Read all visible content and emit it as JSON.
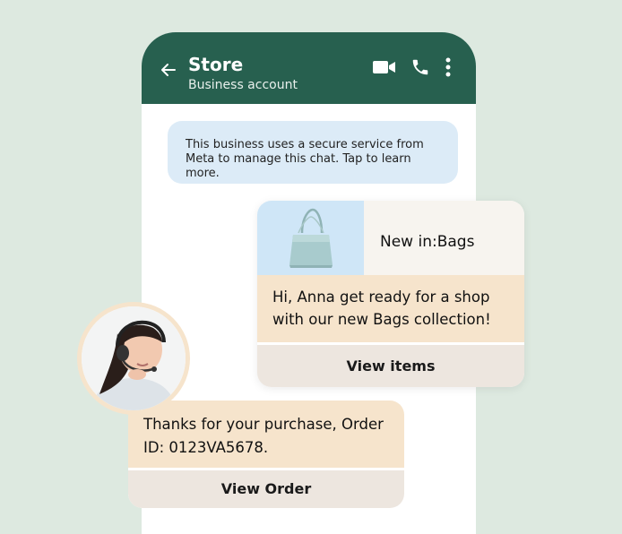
{
  "header": {
    "title": "Store",
    "subtitle": "Business account"
  },
  "notice": {
    "text": "This business uses a secure service from Meta to manage this chat. Tap to learn more."
  },
  "product_card": {
    "name": "New in:Bags",
    "message": "Hi, Anna get ready for a shop with our new Bags collection!",
    "button_label": "View items"
  },
  "order_card": {
    "message": "Thanks for your purchase, Order ID: 0123VA5678.",
    "button_label": "View Order"
  },
  "icons": {
    "back": "arrow-left-icon",
    "video": "video-call-icon",
    "call": "phone-call-icon",
    "menu": "more-vertical-icon",
    "product": "handbag-icon",
    "agent": "support-agent-avatar"
  },
  "colors": {
    "header": "#27604f",
    "page_bg": "#dde9e0",
    "notice_bg": "#dcebf7",
    "message_bg": "#f6e4cc",
    "button_bg": "#ede6df"
  }
}
